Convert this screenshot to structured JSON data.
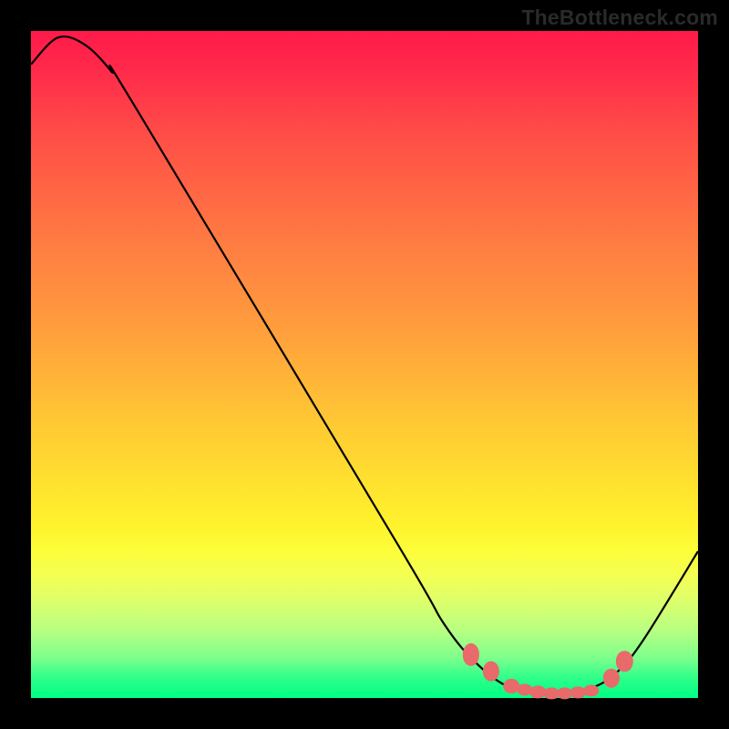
{
  "watermark": "TheBottleneck.com",
  "chart_data": {
    "type": "line",
    "title": "",
    "xlabel": "",
    "ylabel": "",
    "xlim": [
      0,
      100
    ],
    "ylim": [
      0,
      100
    ],
    "curve": [
      {
        "x": 0,
        "y": 95
      },
      {
        "x": 4,
        "y": 99
      },
      {
        "x": 8,
        "y": 98
      },
      {
        "x": 12,
        "y": 94
      },
      {
        "x": 16,
        "y": 88
      },
      {
        "x": 55,
        "y": 23
      },
      {
        "x": 62,
        "y": 11
      },
      {
        "x": 67,
        "y": 5
      },
      {
        "x": 72,
        "y": 1.5
      },
      {
        "x": 78,
        "y": 0.5
      },
      {
        "x": 84,
        "y": 1.5
      },
      {
        "x": 88,
        "y": 4
      },
      {
        "x": 92,
        "y": 9
      },
      {
        "x": 100,
        "y": 22
      }
    ],
    "dots": [
      {
        "x": 66,
        "y": 6.5,
        "w": 2.5,
        "h": 3.3
      },
      {
        "x": 69,
        "y": 4,
        "w": 2.5,
        "h": 3.1
      },
      {
        "x": 72,
        "y": 1.8,
        "w": 2.4,
        "h": 2.2
      },
      {
        "x": 74,
        "y": 1.2,
        "w": 2.4,
        "h": 1.8
      },
      {
        "x": 76,
        "y": 0.9,
        "w": 2.4,
        "h": 1.8
      },
      {
        "x": 78,
        "y": 0.7,
        "w": 2.4,
        "h": 1.8
      },
      {
        "x": 80,
        "y": 0.7,
        "w": 2.4,
        "h": 1.8
      },
      {
        "x": 82,
        "y": 0.8,
        "w": 2.4,
        "h": 1.8
      },
      {
        "x": 84,
        "y": 1.1,
        "w": 2.4,
        "h": 1.8
      },
      {
        "x": 87,
        "y": 3.0,
        "w": 2.5,
        "h": 2.8
      },
      {
        "x": 89,
        "y": 5.5,
        "w": 2.5,
        "h": 3.2
      }
    ]
  }
}
